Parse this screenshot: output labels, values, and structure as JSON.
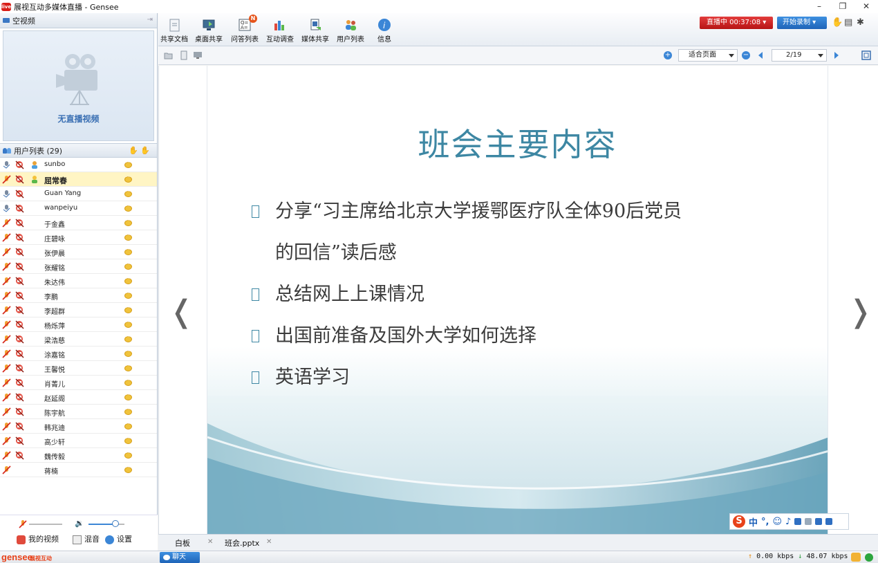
{
  "window": {
    "title": "展视互动多媒体直播 - Gensee",
    "app_icon_text": "live",
    "minimize": "–",
    "restore": "❐",
    "close": "✕"
  },
  "video_panel": {
    "header": "空视频",
    "no_video_text": "无直播视频"
  },
  "user_list": {
    "header": "用户列表 (29)",
    "users": [
      {
        "name": "sunbo",
        "role": true,
        "selected": false
      },
      {
        "name": "屈常春",
        "role": true,
        "selected": true
      },
      {
        "name": "Guan Yang",
        "role": false,
        "selected": false
      },
      {
        "name": "wanpeiyu",
        "role": false,
        "selected": false
      },
      {
        "name": "于金鑫",
        "role": false,
        "selected": false
      },
      {
        "name": "庄碧咏",
        "role": false,
        "selected": false
      },
      {
        "name": "张伊晨",
        "role": false,
        "selected": false
      },
      {
        "name": "张耀铭",
        "role": false,
        "selected": false
      },
      {
        "name": "朱达伟",
        "role": false,
        "selected": false
      },
      {
        "name": "李鹏",
        "role": false,
        "selected": false
      },
      {
        "name": "李超群",
        "role": false,
        "selected": false
      },
      {
        "name": "杨烁萍",
        "role": false,
        "selected": false
      },
      {
        "name": "梁浩慈",
        "role": false,
        "selected": false
      },
      {
        "name": "涂嘉铭",
        "role": false,
        "selected": false
      },
      {
        "name": "王馨悦",
        "role": false,
        "selected": false
      },
      {
        "name": "肖菁儿",
        "role": false,
        "selected": false
      },
      {
        "name": "赵延阁",
        "role": false,
        "selected": false
      },
      {
        "name": "陈宇航",
        "role": false,
        "selected": false
      },
      {
        "name": "韩兆迪",
        "role": false,
        "selected": false
      },
      {
        "name": "高少轩",
        "role": false,
        "selected": false
      },
      {
        "name": "魏传毅",
        "role": false,
        "selected": false
      },
      {
        "name": "蒋楠",
        "role": false,
        "selected": false
      }
    ]
  },
  "left_bottom": {
    "my_video": "我的视频",
    "mix": "混音",
    "settings": "设置"
  },
  "toolbar": {
    "items": [
      {
        "label": "共享文档",
        "icon": "document-icon"
      },
      {
        "label": "桌面共享",
        "icon": "desktop-share-icon"
      },
      {
        "label": "问答列表",
        "icon": "qa-icon",
        "badge": "N"
      },
      {
        "label": "互动调查",
        "icon": "survey-icon"
      },
      {
        "label": "媒体共享",
        "icon": "media-share-icon"
      },
      {
        "label": "用户列表",
        "icon": "user-list-icon"
      },
      {
        "label": "信息",
        "icon": "info-icon"
      }
    ],
    "live_status": "直播中 00:37:08",
    "record_label": "开始录制"
  },
  "doc_toolbar": {
    "fit_mode": "适合页面",
    "page_indicator": "2/19"
  },
  "slide": {
    "title": "班会主要内容",
    "bullets": [
      {
        "line1": "分享“习主席给北京大学援鄂医疗队全体90后党员",
        "line2": "的回信”读后感"
      },
      {
        "line1": "总结网上上课情况",
        "line2": ""
      },
      {
        "line1": "出国前准备及国外大学如何选择",
        "line2": ""
      },
      {
        "line1": "英语学习",
        "line2": ""
      }
    ]
  },
  "ime": {
    "logo": "S",
    "mode": "中"
  },
  "tabs": [
    {
      "label": "白板"
    },
    {
      "label": "班会.pptx"
    }
  ],
  "statusbar": {
    "logo": "gensee",
    "logo_sub": "展视互动",
    "chat_label": "聊天",
    "upload": "0.00 kbps",
    "download": "48.07 kbps"
  },
  "colors": {
    "accent_blue": "#2f78cd",
    "live_red": "#c91e1e",
    "slide_title": "#3d87a3"
  }
}
